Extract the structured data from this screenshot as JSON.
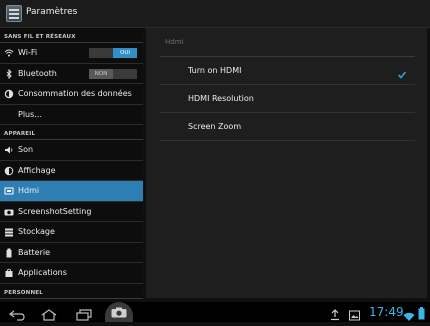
{
  "app": {
    "title": "Paramètres",
    "icon": "settings-icon"
  },
  "left_pane": {
    "sections": [
      {
        "header": "SANS FIL ET RÉSEAUX",
        "items": [
          {
            "label": "Wi-Fi",
            "icon": "wifi-icon",
            "toggle": "OUI",
            "toggle_on": true
          },
          {
            "label": "Bluetooth",
            "icon": "bluetooth-icon",
            "toggle": "NON",
            "toggle_on": false
          },
          {
            "label": "Consommation des données",
            "icon": "data-usage-icon"
          },
          {
            "label": "Plus...",
            "icon": ""
          }
        ]
      },
      {
        "header": "APPAREIL",
        "items": [
          {
            "label": "Son",
            "icon": "volume-icon"
          },
          {
            "label": "Affichage",
            "icon": "brightness-icon"
          },
          {
            "label": "Hdmi",
            "icon": "hdmi-icon",
            "selected": true
          },
          {
            "label": "ScreenshotSetting",
            "icon": "camera-icon"
          },
          {
            "label": "Stockage",
            "icon": "storage-icon"
          },
          {
            "label": "Batterie",
            "icon": "battery-icon"
          },
          {
            "label": "Applications",
            "icon": "apps-icon"
          }
        ]
      },
      {
        "header": "PERSONNEL",
        "items": []
      }
    ]
  },
  "right_pane": {
    "header": "Hdmi",
    "items": [
      {
        "label": "Turn on HDMI",
        "checked": true
      },
      {
        "label": "HDMI Resolution"
      },
      {
        "label": "Screen Zoom"
      }
    ]
  },
  "navbar": {
    "buttons": [
      "back-icon",
      "home-icon",
      "recent-apps-icon",
      "screenshot-camera-icon"
    ],
    "status_icons": [
      "usb-upload-icon",
      "image-notification-icon",
      "wifi-icon",
      "battery-icon"
    ],
    "time": "17:49"
  },
  "colors": {
    "accent": "#2c7eb3",
    "clock": "#38b6ea"
  }
}
